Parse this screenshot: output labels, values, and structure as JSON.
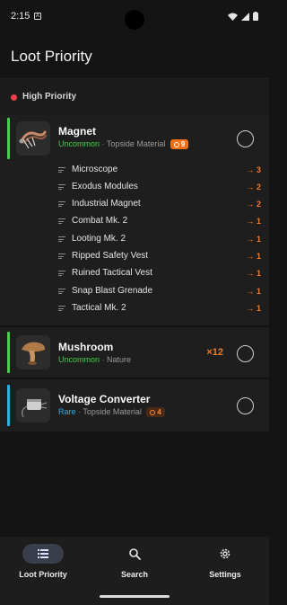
{
  "status_bar": {
    "time": "2:15",
    "notification_glyph": "A"
  },
  "app_bar": {
    "title": "Loot Priority"
  },
  "section": {
    "label": "High Priority",
    "dot_color": "#ef3f4a"
  },
  "items": [
    {
      "name": "Magnet",
      "rarity": "Uncommon",
      "category": "Topside Material",
      "badge": "9",
      "accent_color": "#45d04a",
      "required_by": [
        {
          "label": "Microscope",
          "count": "→ 3"
        },
        {
          "label": "Exodus Modules",
          "count": "→ 2"
        },
        {
          "label": "Industrial Magnet",
          "count": "→ 2"
        },
        {
          "label": "Combat Mk. 2",
          "count": "→ 1"
        },
        {
          "label": "Looting Mk. 2",
          "count": "→ 1"
        },
        {
          "label": "Ripped Safety Vest",
          "count": "→ 1"
        },
        {
          "label": "Ruined Tactical Vest",
          "count": "→ 1"
        },
        {
          "label": "Snap Blast Grenade",
          "count": "→ 1"
        },
        {
          "label": "Tactical Mk. 2",
          "count": "→ 1"
        }
      ]
    },
    {
      "name": "Mushroom",
      "rarity": "Uncommon",
      "category": "Nature",
      "quantity": "×12",
      "accent_color": "#45d04a"
    },
    {
      "name": "Voltage Converter",
      "rarity": "Rare",
      "category": "Topside Material",
      "badge": "4",
      "accent_color": "#2eaee6"
    }
  ],
  "bottom_nav": [
    {
      "label": "Loot Priority",
      "icon": "list-icon",
      "active": true
    },
    {
      "label": "Search",
      "icon": "search-icon",
      "active": false
    },
    {
      "label": "Settings",
      "icon": "gear-icon",
      "active": false
    }
  ],
  "colors": {
    "accent_orange": "#f07013",
    "uncommon": "#45d04a",
    "rare": "#2eaee6",
    "background": "#141414"
  }
}
